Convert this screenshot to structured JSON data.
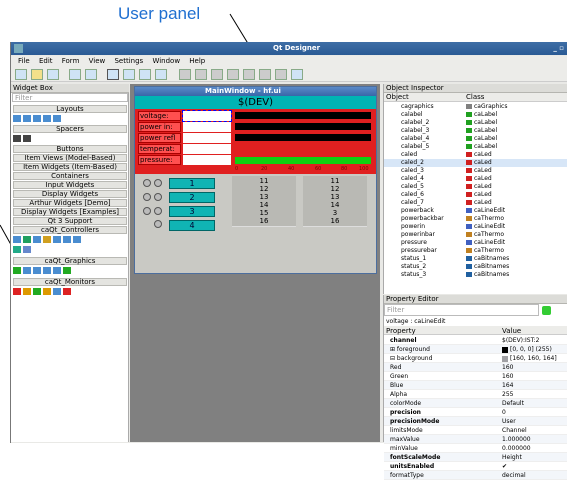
{
  "callout": {
    "label": "User panel"
  },
  "window": {
    "title": "Qt Designer",
    "controls": "_ ▫"
  },
  "menu": [
    "File",
    "Edit",
    "Form",
    "View",
    "Settings",
    "Window",
    "Help"
  ],
  "widget_box": {
    "title": "Widget Box",
    "filter_placeholder": "Filter",
    "categories": [
      "Layouts",
      "Spacers",
      "Buttons",
      "Item Views (Model-Based)",
      "Item Widgets (Item-Based)",
      "Containers",
      "Input Widgets",
      "Display Widgets",
      "Arthur Widgets [Demo]",
      "Display Widgets [Examples]",
      "Qt 3 Support",
      "caQt_Controllers",
      "caQt_Graphics",
      "caQt_Monitors"
    ]
  },
  "form": {
    "title": "MainWindow - hf.ui",
    "header": "$(DEV)",
    "labels": [
      "voltage:",
      "power in:",
      "power refl",
      "temperat:",
      "pressure:"
    ],
    "scale_ticks": [
      "0",
      "20",
      "40",
      "60",
      "80",
      "100"
    ],
    "buttons": [
      "1",
      "2",
      "3",
      "4"
    ],
    "col1": [
      "11",
      "12",
      "13",
      "14",
      "15",
      "16"
    ],
    "col2": [
      "11",
      "12",
      "13",
      "14",
      "3",
      "16"
    ]
  },
  "object_inspector": {
    "title": "Object Inspector",
    "col_object": "Object",
    "col_class": "Class",
    "rows": [
      {
        "o": "cagraphics",
        "c": "caGraphics",
        "color": "#808080"
      },
      {
        "o": "calabel",
        "c": "caLabel",
        "color": "#20a020"
      },
      {
        "o": "calabel_2",
        "c": "caLabel",
        "color": "#20a020"
      },
      {
        "o": "calabel_3",
        "c": "caLabel",
        "color": "#20a020"
      },
      {
        "o": "calabel_4",
        "c": "caLabel",
        "color": "#20a020"
      },
      {
        "o": "calabel_5",
        "c": "caLabel",
        "color": "#20a020"
      },
      {
        "o": "caled",
        "c": "caLed",
        "color": "#d02020"
      },
      {
        "o": "caled_2",
        "c": "caLed",
        "color": "#d02020"
      },
      {
        "o": "caled_3",
        "c": "caLed",
        "color": "#d02020"
      },
      {
        "o": "caled_4",
        "c": "caLed",
        "color": "#d02020"
      },
      {
        "o": "caled_5",
        "c": "caLed",
        "color": "#d02020"
      },
      {
        "o": "caled_6",
        "c": "caLed",
        "color": "#d02020"
      },
      {
        "o": "caled_7",
        "c": "caLed",
        "color": "#d02020"
      },
      {
        "o": "powerback",
        "c": "caLineEdit",
        "color": "#4060c0"
      },
      {
        "o": "powerbackbar",
        "c": "caThermo",
        "color": "#c08020"
      },
      {
        "o": "powerin",
        "c": "caLineEdit",
        "color": "#4060c0"
      },
      {
        "o": "powerinbar",
        "c": "caThermo",
        "color": "#c08020"
      },
      {
        "o": "pressure",
        "c": "caLineEdit",
        "color": "#4060c0"
      },
      {
        "o": "pressurebar",
        "c": "caThermo",
        "color": "#c08020"
      },
      {
        "o": "status_1",
        "c": "caBitnames",
        "color": "#2060a0"
      },
      {
        "o": "status_2",
        "c": "caBitnames",
        "color": "#2060a0"
      },
      {
        "o": "status_3",
        "c": "caBitnames",
        "color": "#2060a0"
      }
    ]
  },
  "property_editor": {
    "title": "Property Editor",
    "filter_placeholder": "Filter",
    "context": "voltage : caLineEdit",
    "col_property": "Property",
    "col_value": "Value",
    "rows": [
      {
        "k": "channel",
        "v": "$(DEV):IST:2",
        "bold": true
      },
      {
        "k": "⊞ foreground",
        "v": "[0, 0, 0] (255)",
        "swatch": "#000000"
      },
      {
        "k": "⊟ background",
        "v": "[160, 160, 164] (255)",
        "swatch": "#a0a0a4"
      },
      {
        "k": "   Red",
        "v": "160"
      },
      {
        "k": "   Green",
        "v": "160"
      },
      {
        "k": "   Blue",
        "v": "164"
      },
      {
        "k": "   Alpha",
        "v": "255"
      },
      {
        "k": "colorMode",
        "v": "Default"
      },
      {
        "k": "precision",
        "v": "0",
        "bold": true
      },
      {
        "k": "precisionMode",
        "v": "User",
        "bold": true
      },
      {
        "k": "limitsMode",
        "v": "Channel"
      },
      {
        "k": "maxValue",
        "v": "1.000000"
      },
      {
        "k": "minValue",
        "v": "0.000000"
      },
      {
        "k": "fontScaleMode",
        "v": "Height",
        "bold": true
      },
      {
        "k": "unitsEnabled",
        "v": "✔",
        "bold": true
      },
      {
        "k": "formatType",
        "v": "decimal"
      }
    ]
  }
}
